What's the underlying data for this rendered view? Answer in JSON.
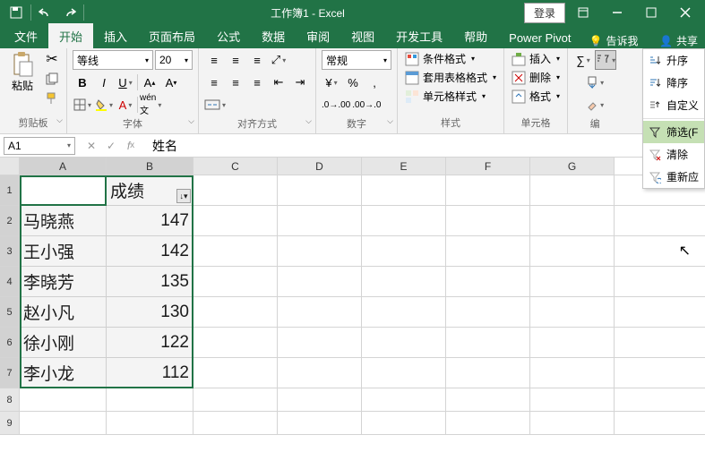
{
  "title": "工作簿1 - Excel",
  "login": "登录",
  "tabs": {
    "file": "文件",
    "home": "开始",
    "insert": "插入",
    "layout": "页面布局",
    "formulas": "公式",
    "data": "数据",
    "review": "审阅",
    "view": "视图",
    "dev": "开发工具",
    "help": "帮助",
    "pivot": "Power Pivot",
    "tell": "告诉我",
    "share": "共享"
  },
  "ribbon": {
    "clipboard": {
      "label": "剪贴板",
      "paste": "粘贴"
    },
    "font": {
      "label": "字体",
      "name": "等线",
      "size": "20"
    },
    "align": {
      "label": "对齐方式"
    },
    "number": {
      "label": "数字",
      "format": "常规"
    },
    "styles": {
      "label": "样式",
      "cond": "条件格式",
      "table": "套用表格格式",
      "cell": "单元格样式"
    },
    "cells": {
      "label": "单元格",
      "insert": "插入",
      "delete": "删除",
      "format": "格式"
    },
    "editing": {
      "label": "编"
    }
  },
  "sort_menu": {
    "asc": "升序",
    "desc": "降序",
    "custom": "自定义",
    "filter": "筛选(F",
    "clear": "清除",
    "reapply": "重新应"
  },
  "name_box": "A1",
  "formula": "姓名",
  "columns": [
    "A",
    "B",
    "C",
    "D",
    "E",
    "F",
    "G"
  ],
  "headers": {
    "name": "姓名",
    "score": "成绩"
  },
  "data_rows": [
    {
      "name": "马晓燕",
      "score": "147"
    },
    {
      "name": "王小强",
      "score": "142"
    },
    {
      "name": "李晓芳",
      "score": "135"
    },
    {
      "name": "赵小凡",
      "score": "130"
    },
    {
      "name": "徐小刚",
      "score": "122"
    },
    {
      "name": "李小龙",
      "score": "112"
    }
  ]
}
